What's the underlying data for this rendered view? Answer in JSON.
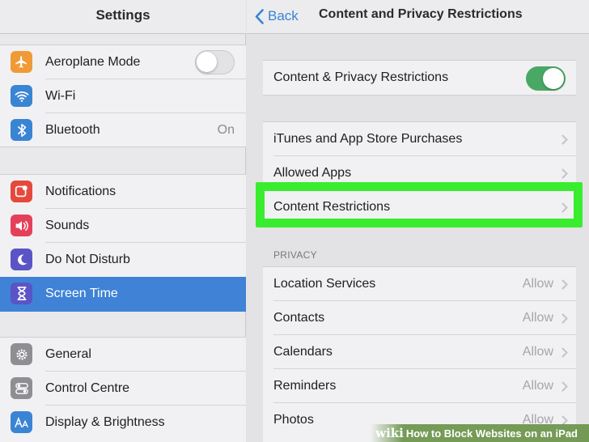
{
  "sidebar": {
    "title": "Settings",
    "groups": [
      {
        "items": [
          {
            "label": "Aeroplane Mode",
            "icon": "airplane-icon",
            "icon_color": "#f09a37",
            "control": "toggle",
            "toggle_on": false
          },
          {
            "label": "Wi-Fi",
            "icon": "wifi-icon",
            "icon_color": "#3a84d4"
          },
          {
            "label": "Bluetooth",
            "icon": "bluetooth-icon",
            "icon_color": "#3a84d4",
            "value": "On"
          }
        ]
      },
      {
        "items": [
          {
            "label": "Notifications",
            "icon": "notifications-icon",
            "icon_color": "#e5493c"
          },
          {
            "label": "Sounds",
            "icon": "speaker-icon",
            "icon_color": "#e5405a"
          },
          {
            "label": "Do Not Disturb",
            "icon": "moon-icon",
            "icon_color": "#5b54c7"
          },
          {
            "label": "Screen Time",
            "icon": "hourglass-icon",
            "icon_color": "#5b54c7",
            "selected": true
          }
        ]
      },
      {
        "items": [
          {
            "label": "General",
            "icon": "gear-icon",
            "icon_color": "#8e8e93"
          },
          {
            "label": "Control Centre",
            "icon": "switches-icon",
            "icon_color": "#8e8e93"
          },
          {
            "label": "Display & Brightness",
            "icon": "text-size-icon",
            "icon_color": "#3a84d4"
          }
        ]
      }
    ]
  },
  "main": {
    "back_label": "Back",
    "title": "Content and Privacy Restrictions",
    "master_toggle": {
      "label": "Content & Privacy Restrictions",
      "on": true
    },
    "store_items": [
      {
        "label": "iTunes and App Store Purchases"
      },
      {
        "label": "Allowed Apps"
      },
      {
        "label": "Content Restrictions",
        "highlighted": true
      }
    ],
    "privacy_header": "PRIVACY",
    "privacy_items": [
      {
        "label": "Location Services",
        "value": "Allow"
      },
      {
        "label": "Contacts",
        "value": "Allow"
      },
      {
        "label": "Calendars",
        "value": "Allow"
      },
      {
        "label": "Reminders",
        "value": "Allow"
      },
      {
        "label": "Photos",
        "value": "Allow"
      }
    ]
  },
  "colors": {
    "accent": "#3a84d4",
    "toggle_on": "#4aa865",
    "highlight": "#39ec2e",
    "selected_row": "#3f82d6"
  },
  "watermark": {
    "logo": "wiki",
    "text": "How to Block Websites on an iPad"
  }
}
